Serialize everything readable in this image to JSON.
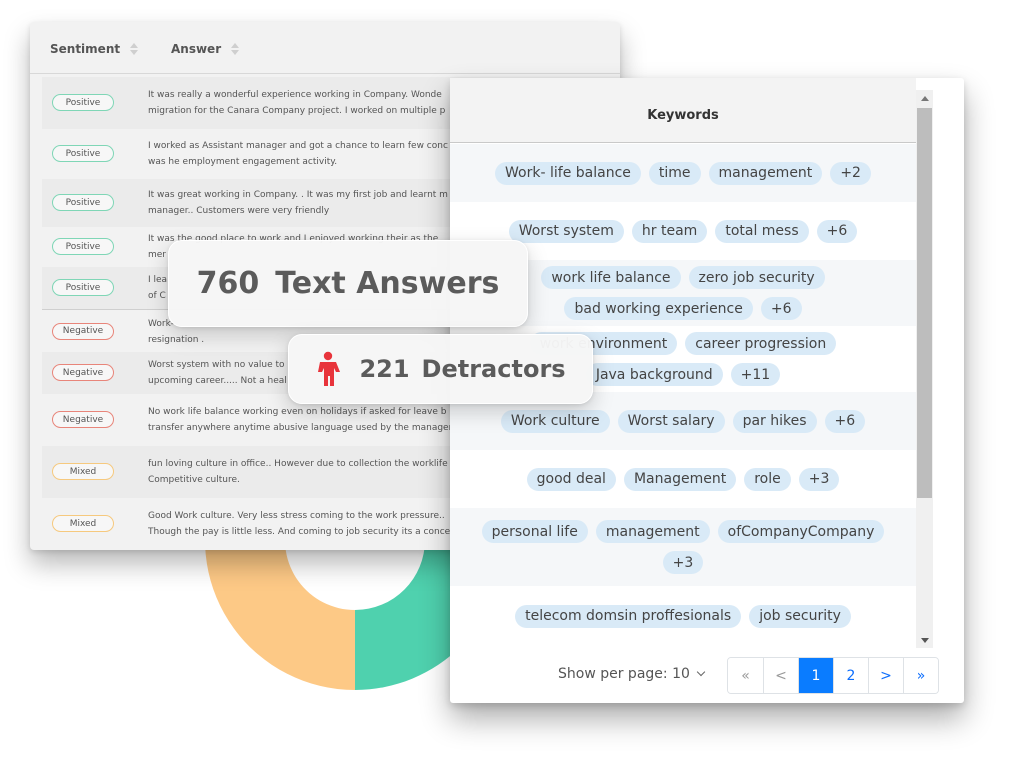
{
  "donut": {
    "segments": [
      {
        "label": "Positive",
        "color": "#4fd1ae",
        "share": 0.5
      },
      {
        "label": "Mixed",
        "color": "#fdc986",
        "share": 0.3
      },
      {
        "label": "Negative",
        "color": "#c0353b",
        "share": 0.2
      }
    ]
  },
  "table": {
    "headers": {
      "sentiment": "Sentiment",
      "answer": "Answer"
    },
    "rows": [
      {
        "sentiment": "Positive",
        "type": "pos",
        "lines": [
          "It was really a wonderful experience working in Company. Wonde",
          "migration for the Canara Company project. I worked on multiple p"
        ]
      },
      {
        "sentiment": "Positive",
        "type": "pos",
        "lines": [
          "I worked as Assistant manager and got a chance to learn few conc",
          "was he employment engagement activity."
        ]
      },
      {
        "sentiment": "Positive",
        "type": "pos",
        "lines": [
          "It was great working in Company. . It was my first job and learnt m",
          "manager.. Customers were very friendly"
        ]
      },
      {
        "sentiment": "Positive",
        "type": "pos",
        "lines": [
          "It was the good place to work and I enjoyed working their as the",
          "mer"
        ]
      },
      {
        "sentiment": "Positive",
        "type": "pos",
        "lines": [
          "I lea",
          "of C"
        ]
      },
      {
        "sentiment": "Negative",
        "type": "neg",
        "lines": [
          "Work-",
          "resignation ."
        ]
      },
      {
        "sentiment": "Negative",
        "type": "neg",
        "lines": [
          "Worst system with no value to",
          "upcoming career..... Not a heal"
        ]
      },
      {
        "sentiment": "Negative",
        "type": "neg",
        "lines": [
          "No work life balance working even on holidays if asked for leave b",
          "transfer anywhere anytime abusive language used by the manager"
        ]
      },
      {
        "sentiment": "Mixed",
        "type": "mix",
        "lines": [
          "fun loving culture in office.. However due to collection the worklife",
          "Competitive culture."
        ]
      },
      {
        "sentiment": "Mixed",
        "type": "mix",
        "lines": [
          "Good Work culture. Very less stress coming to the work pressure..",
          "Though the pay is little less. And coming to job security its a conce"
        ]
      }
    ]
  },
  "stats": {
    "answers_count": "760",
    "answers_label": "Text Answers",
    "detractors_count": "221",
    "detractors_label": "Detractors",
    "detractor_icon_color": "#e8343b"
  },
  "keywords": {
    "title": "Keywords",
    "rows": [
      [
        "Work- life balance",
        "time",
        "management",
        "+2"
      ],
      [
        "Worst system",
        "hr team",
        "total mess",
        "+6"
      ],
      [
        "work life balance",
        "zero job security",
        "bad working experience",
        "+6"
      ],
      [
        "work environment",
        "career progression",
        "Java background",
        "+11"
      ],
      [
        "Work culture",
        "Worst salary",
        "par hikes",
        "+6"
      ],
      [
        "good deal",
        "Management",
        "role",
        "+3"
      ],
      [
        "personal life",
        "management",
        "ofCompanyCompany",
        "+3"
      ],
      [
        "telecom domsin proffesionals",
        "job security"
      ]
    ],
    "per_page_label": "Show per page: 10",
    "pagination": {
      "first": "«",
      "prev": "<",
      "pages": [
        "1",
        "2"
      ],
      "current": "1",
      "next": ">",
      "last": "»"
    },
    "accent_color": "#0a7cff"
  }
}
